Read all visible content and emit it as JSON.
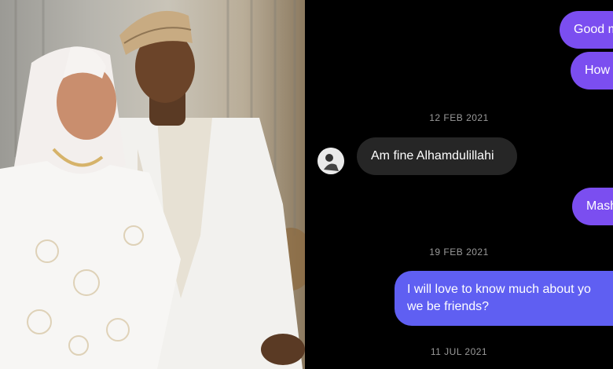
{
  "chat": {
    "messages": [
      {
        "text": "Good m",
        "from": "me"
      },
      {
        "text": "How",
        "from": "me"
      },
      {
        "date": "12 FEB 2021"
      },
      {
        "text": "Am fine Alhamdulillahi",
        "from": "them"
      },
      {
        "text": "Mash",
        "from": "me"
      },
      {
        "date": "19 FEB 2021"
      },
      {
        "line1": "I will love to know much about yo",
        "line2": "we be friends?",
        "from": "me"
      },
      {
        "date": "11 JUL 2021"
      }
    ],
    "colors": {
      "outgoing": "#7b4ef0",
      "incoming": "#262626",
      "background": "#000000"
    }
  },
  "photo": {
    "subject": "couple-in-white-traditional-attire"
  }
}
